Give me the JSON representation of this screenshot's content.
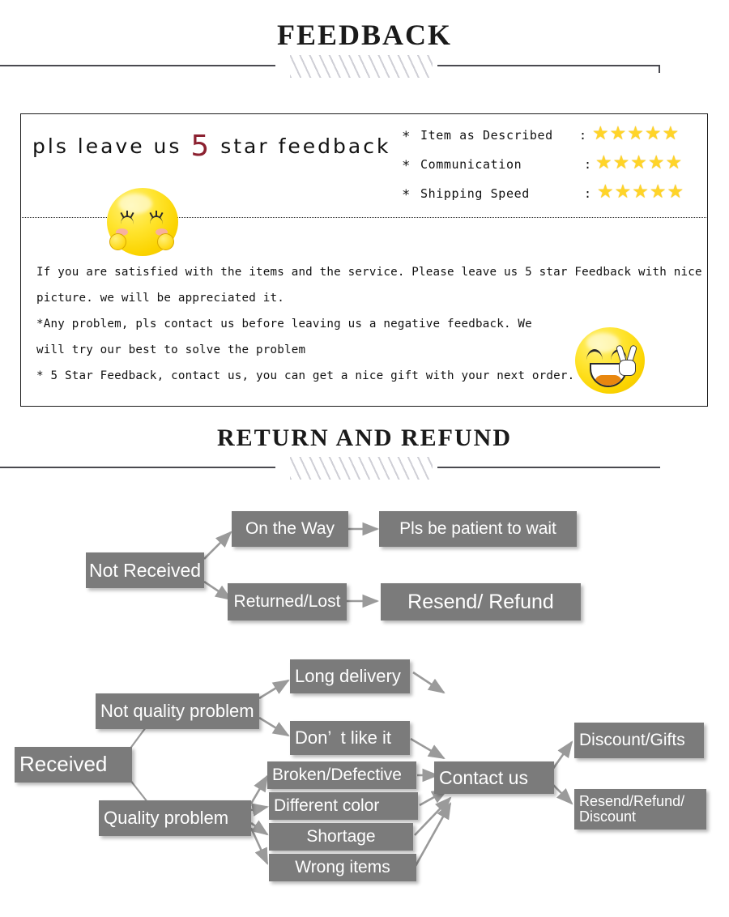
{
  "sections": {
    "feedback": {
      "title": "FEEDBACK",
      "headline_prefix": "pls leave us ",
      "headline_number": "5",
      "headline_suffix": " star feedback",
      "ratings": [
        {
          "bullet": "*",
          "label": "Item as Described",
          "colon": ":",
          "stars": "★★★★★",
          "value": 5
        },
        {
          "bullet": "*",
          "label": "Communication",
          "colon": ":",
          "stars": "★★★★★",
          "value": 5
        },
        {
          "bullet": "*",
          "label": "Shipping Speed",
          "colon": ":",
          "stars": "★★★★★",
          "value": 5
        }
      ],
      "body_lines": [
        "If you are satisfied with the items and the service. Please leave us 5 star Feedback with nice",
        "picture. we will be appreciated it.",
        "*Any problem, pls contact us before leaving us a negative feedback. We",
        "will try our best to solve  the problem",
        "* 5 Star Feedback, contact us, you can get a nice gift with your next order."
      ]
    },
    "return_refund": {
      "title": "RETURN  AND  REFUND",
      "flow_not_received": {
        "root": "Not Received",
        "branches": [
          {
            "condition": "On the Way",
            "outcome": "Pls be patient to wait"
          },
          {
            "condition": "Returned/Lost",
            "outcome": "Resend/ Refund"
          }
        ]
      },
      "flow_received": {
        "root": "Received",
        "not_quality": {
          "label": "Not quality problem",
          "reasons": [
            "Long delivery",
            "Don’  t like it"
          ]
        },
        "quality": {
          "label": "Quality problem",
          "reasons": [
            "Broken/Defective",
            "Different color",
            "Shortage",
            "Wrong items"
          ]
        },
        "hub": "Contact us",
        "outcomes": [
          "Discount/Gifts",
          "Resend/Refund/\nDiscount"
        ]
      }
    }
  },
  "colors": {
    "node_fill": "#7b7b7b",
    "node_text": "#ffffff",
    "accent_five": "#8c2130",
    "star": "#FFD428",
    "rule": "#4a4a50"
  }
}
